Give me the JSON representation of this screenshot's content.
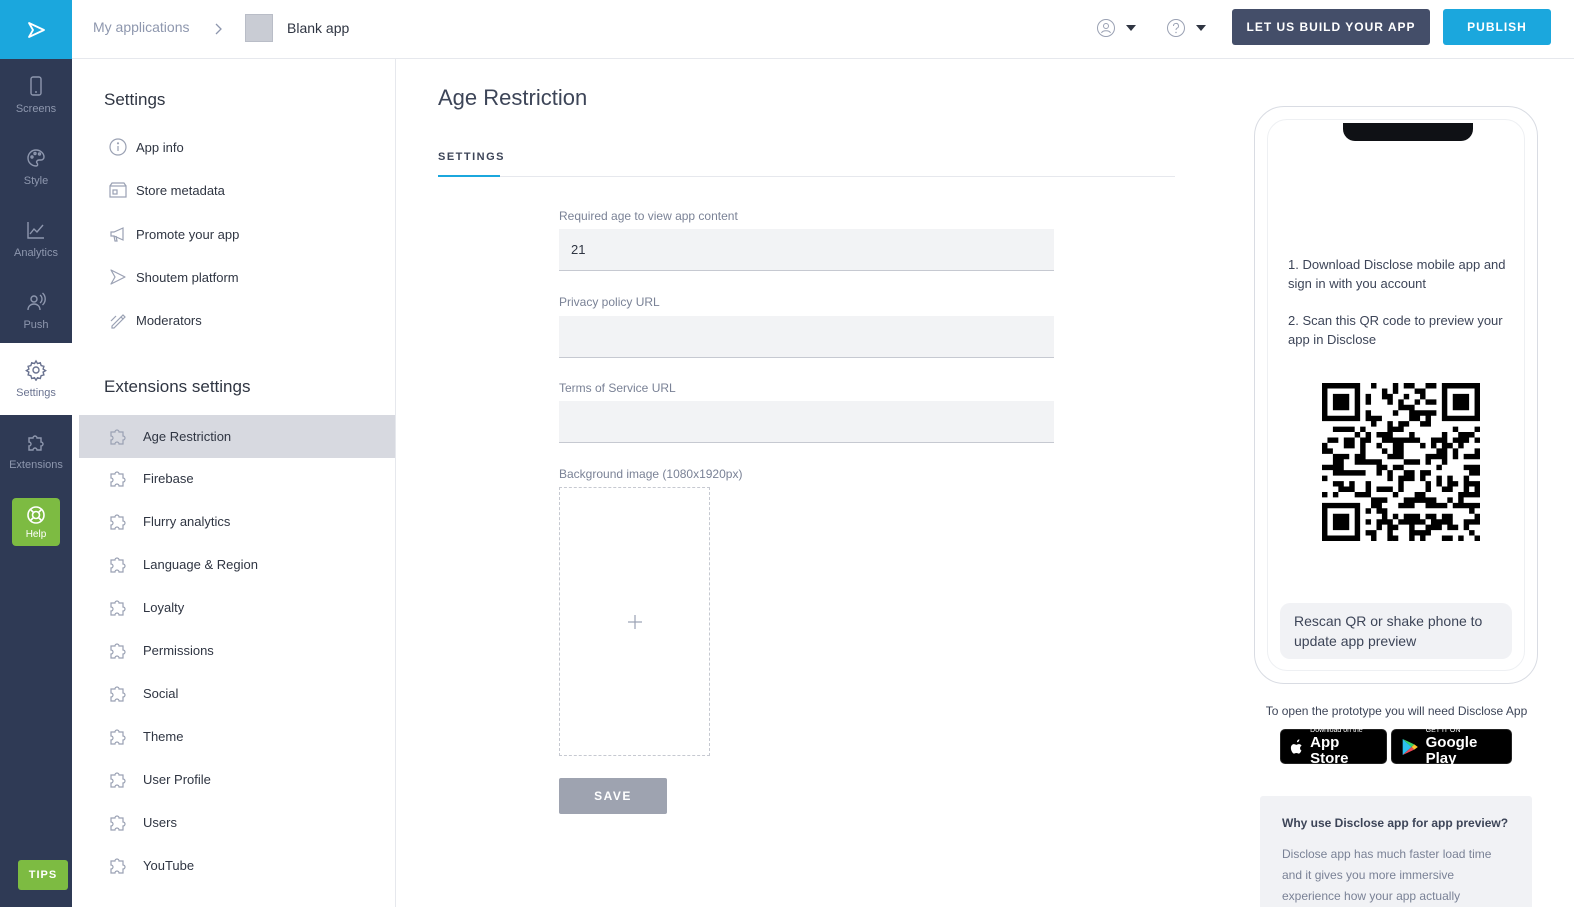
{
  "rail": {
    "items": [
      {
        "label": "Screens",
        "icon": "phone-icon"
      },
      {
        "label": "Style",
        "icon": "palette-icon"
      },
      {
        "label": "Analytics",
        "icon": "chart-icon"
      },
      {
        "label": "Push",
        "icon": "push-icon"
      },
      {
        "label": "Settings",
        "icon": "gear-icon"
      },
      {
        "label": "Extensions",
        "icon": "puzzle-icon"
      }
    ],
    "help_label": "Help",
    "tips_label": "TIPS"
  },
  "topbar": {
    "breadcrumb_root": "My applications",
    "app_name": "Blank app",
    "build_label": "LET US BUILD YOUR APP",
    "publish_label": "PUBLISH"
  },
  "sidebar": {
    "settings_heading": "Settings",
    "settings_items": [
      {
        "label": "App info",
        "icon": "info-icon"
      },
      {
        "label": "Store metadata",
        "icon": "store-icon"
      },
      {
        "label": "Promote your app",
        "icon": "megaphone-icon"
      },
      {
        "label": "Shoutem platform",
        "icon": "shoutem-icon"
      },
      {
        "label": "Moderators",
        "icon": "moderator-icon"
      }
    ],
    "extensions_heading": "Extensions settings",
    "extension_items": [
      {
        "label": "Age Restriction",
        "active": true
      },
      {
        "label": "Firebase"
      },
      {
        "label": "Flurry analytics"
      },
      {
        "label": "Language & Region"
      },
      {
        "label": "Loyalty"
      },
      {
        "label": "Permissions"
      },
      {
        "label": "Social"
      },
      {
        "label": "Theme"
      },
      {
        "label": "User Profile"
      },
      {
        "label": "Users"
      },
      {
        "label": "YouTube"
      }
    ]
  },
  "main": {
    "title": "Age Restriction",
    "tab_label": "SETTINGS",
    "fields": [
      {
        "label": "Required age to view app content",
        "value": "21"
      },
      {
        "label": "Privacy policy URL",
        "value": ""
      },
      {
        "label": "Terms of Service URL",
        "value": ""
      }
    ],
    "background_label": "Background image (1080x1920px)",
    "save_label": "SAVE"
  },
  "preview": {
    "step1": "1. Download Disclose mobile app and sign in with you account",
    "step2": "2. Scan this QR code to preview your app in Disclose",
    "rescan": "Rescan QR or shake phone to update app preview",
    "prototype_note": "To open the prototype you will need Disclose App",
    "app_store_small": "Download on the",
    "app_store_big": "App Store",
    "google_small": "GET IT ON",
    "google_big": "Google Play",
    "why_title": "Why use Disclose app for app preview?",
    "why_body": "Disclose app has much faster load time and it gives you more immersive experience how your app actually"
  },
  "colors": {
    "accent": "#1ba7dd",
    "rail": "#2f3a55",
    "help_green": "#7dbb42"
  }
}
